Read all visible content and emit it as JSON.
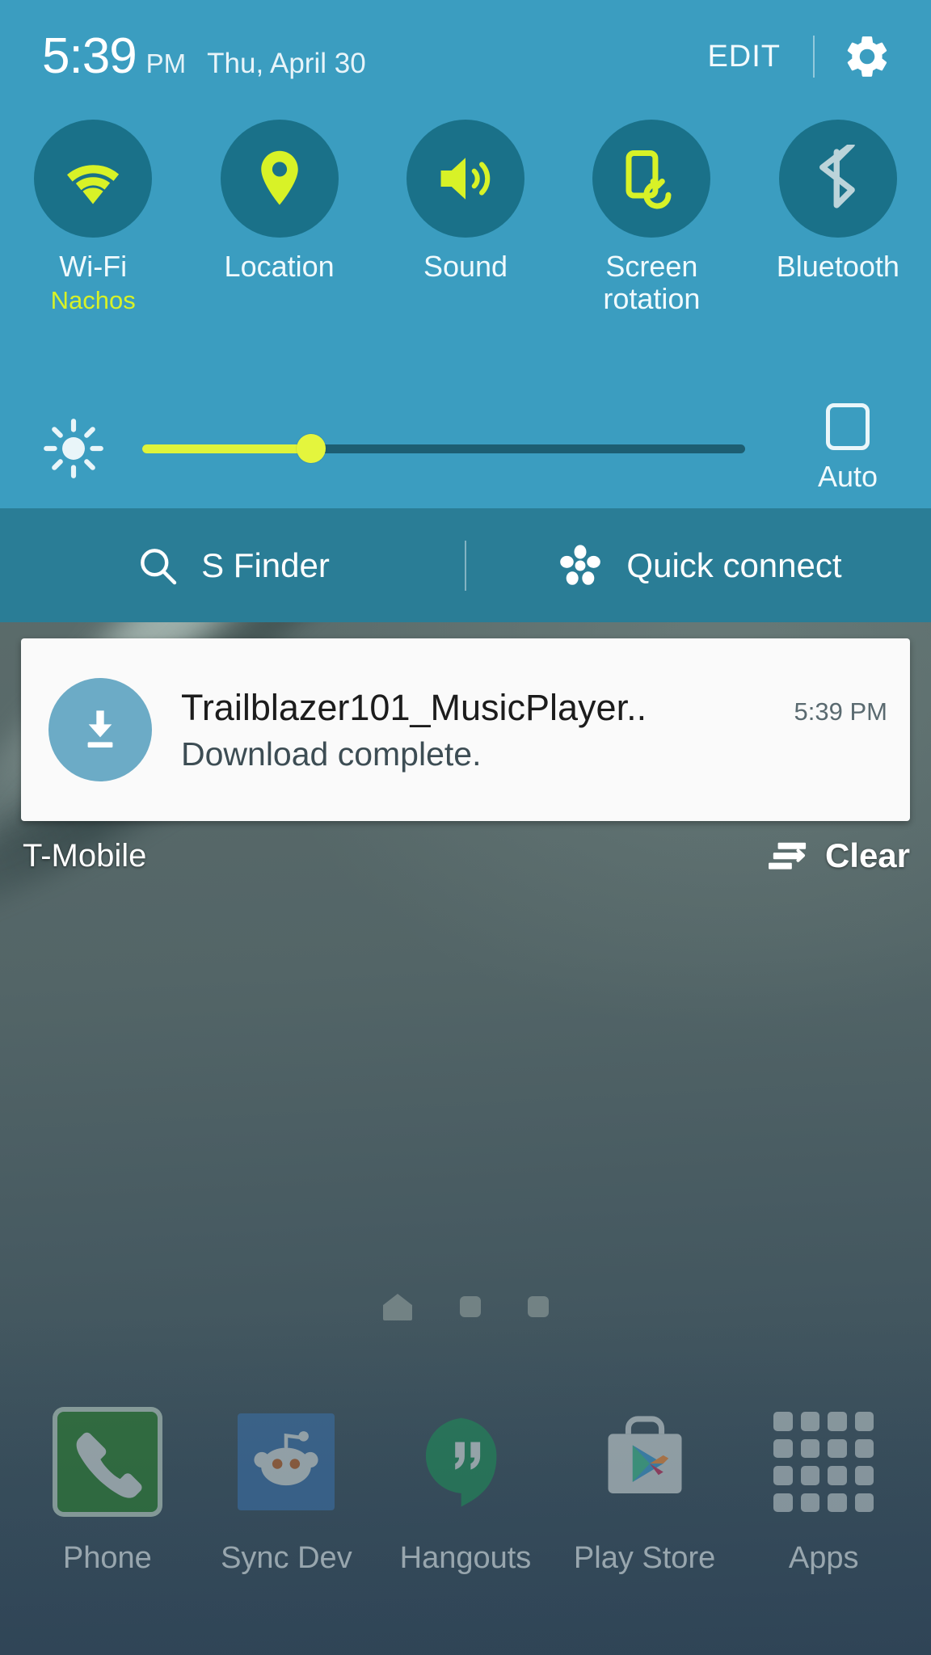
{
  "status_bar": {
    "time": "5:39",
    "ampm": "PM",
    "date": "Thu, April 30",
    "edit_label": "EDIT",
    "gear_icon": "gear-icon"
  },
  "quick_settings": {
    "toggles": [
      {
        "label": "Wi-Fi",
        "sub": "Nachos",
        "icon": "wifi-icon",
        "state": "on",
        "icon_color": "#d8f227"
      },
      {
        "label": "Location",
        "sub": "",
        "icon": "location-pin-icon",
        "state": "on",
        "icon_color": "#d8f227"
      },
      {
        "label": "Sound",
        "sub": "",
        "icon": "speaker-icon",
        "state": "on",
        "icon_color": "#d8f227"
      },
      {
        "label": "Screen rotation",
        "sub": "",
        "icon": "screen-rotation-icon",
        "state": "on",
        "icon_color": "#d8f227"
      },
      {
        "label": "Bluetooth",
        "sub": "",
        "icon": "bluetooth-icon",
        "state": "off",
        "icon_color": "#bcd4da"
      }
    ],
    "circle_color": "#1a7189",
    "panel_color": "#3b9dc0"
  },
  "brightness": {
    "icon": "brightness-sun-icon",
    "value_percent": 28,
    "fill_color": "#dff43a",
    "track_color": "#1d5e72",
    "auto_label": "Auto",
    "auto_checked": false
  },
  "finder_bar": {
    "background": "#2a7d96",
    "items": [
      {
        "label": "S Finder",
        "icon": "search-icon"
      },
      {
        "label": "Quick connect",
        "icon": "quick-connect-icon"
      }
    ]
  },
  "notification": {
    "icon": "download-complete-icon",
    "icon_color": "#6cabc6",
    "title": "Trailblazer101_MusicPlayer..",
    "time": "5:39 PM",
    "subtitle": "Download complete."
  },
  "carrier_row": {
    "carrier": "T-Mobile",
    "clear_label": "Clear",
    "clear_icon": "clear-notifications-icon"
  },
  "home_screen": {
    "page_indicators": [
      {
        "type": "home",
        "active": true
      },
      {
        "type": "square",
        "active": false
      },
      {
        "type": "square",
        "active": false
      }
    ],
    "dock": [
      {
        "label": "Phone",
        "icon": "phone-icon"
      },
      {
        "label": "Sync Dev",
        "icon": "reddit-alien-icon"
      },
      {
        "label": "Hangouts",
        "icon": "hangouts-icon"
      },
      {
        "label": "Play Store",
        "icon": "play-store-icon"
      },
      {
        "label": "Apps",
        "icon": "apps-grid-icon"
      }
    ]
  }
}
